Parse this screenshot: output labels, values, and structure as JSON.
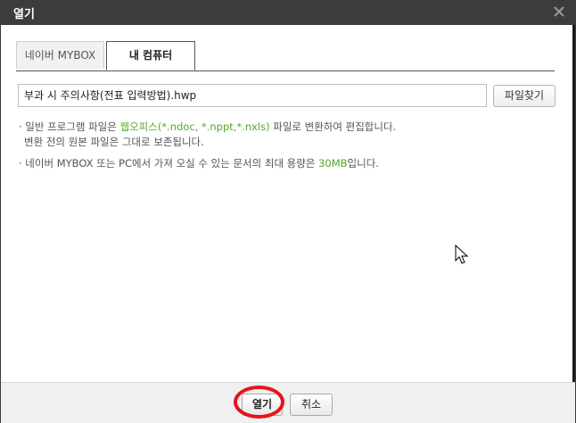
{
  "dialog": {
    "title": "열기",
    "close_icon": "close-icon"
  },
  "tabs": [
    {
      "label": "네이버 MYBOX",
      "active": false
    },
    {
      "label": "내 컴퓨터",
      "active": true
    }
  ],
  "file": {
    "value": "부과 시 주의사항(전표 입력방법).hwp",
    "find_button": "파일찾기"
  },
  "notes": {
    "line1_a": "· 일반 프로그램 파일은 ",
    "line1_green": "웹오피스(*.ndoc, *.nppt,*.nxls)",
    "line1_b": " 파일로 변환하여 편집합니다.",
    "line2": "변환 전의 원본 파일은 그대로 보존됩니다.",
    "line3_a": "· 네이버 MYBOX 또는 PC에서 가져 오실 수 있는 문서의 최대 용량은 ",
    "line3_green": "30MB",
    "line3_b": "입니다."
  },
  "footer": {
    "open_label": "열기",
    "cancel_label": "취소"
  },
  "colors": {
    "titlebar": "#3c3c3c",
    "highlight_green": "#5aa82a",
    "annotation_red": "#e8141b"
  }
}
